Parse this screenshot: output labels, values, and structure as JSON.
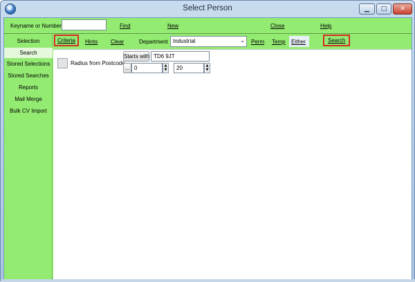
{
  "window": {
    "title": "Select Person"
  },
  "toolbar": {
    "keyname_label": "Keyname or Number",
    "keyname_value": "",
    "find": "Find",
    "new": "New",
    "close": "Close",
    "help": "Help"
  },
  "sidebar": {
    "items": [
      {
        "label": "Selection"
      },
      {
        "label": "Search"
      },
      {
        "label": "Stored Selections"
      },
      {
        "label": "Stored Searches"
      },
      {
        "label": "Reports"
      },
      {
        "label": "Mail Merge"
      },
      {
        "label": "Bulk CV Import"
      }
    ]
  },
  "toolbar2": {
    "criteria": "Criteria",
    "hints": "Hints",
    "clear": "Clear",
    "department_label": "Department",
    "department_value": "Industrial",
    "perm": "Perm",
    "temp": "Temp",
    "either": "Either",
    "search": "Search"
  },
  "criteria": {
    "radius_label": "Radius from Postcode",
    "starts_with": "Starts with",
    "postcode_value": "TD6 9JT",
    "ellipsis": "...",
    "min_value": "0",
    "max_value": "20"
  },
  "colors": {
    "panel_green": "#94eb72",
    "highlight_red": "#d42a1e"
  }
}
